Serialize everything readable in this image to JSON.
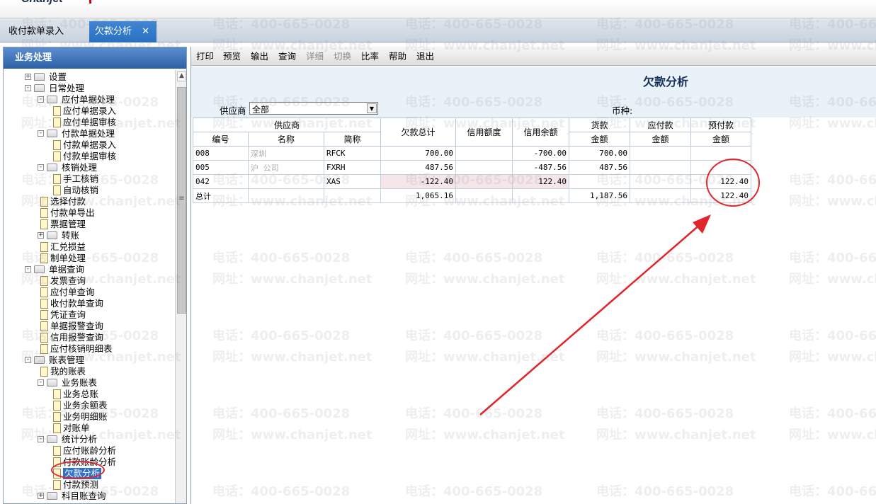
{
  "brand": {
    "name": "Chanjet"
  },
  "tabs": [
    {
      "label": "收付款单录入"
    },
    {
      "label": "欠款分析",
      "close": "✕"
    }
  ],
  "sidebar": {
    "title": "业务处理",
    "nodes": [
      {
        "label": "设置"
      },
      {
        "label": "日常处理"
      },
      {
        "label": "应付单据处理"
      },
      {
        "label": "应付单据录入"
      },
      {
        "label": "应付单据审核"
      },
      {
        "label": "付款单据处理"
      },
      {
        "label": "付款单据录入"
      },
      {
        "label": "付款单据审核"
      },
      {
        "label": "核销处理"
      },
      {
        "label": "手工核销"
      },
      {
        "label": "自动核销"
      },
      {
        "label": "选择付款"
      },
      {
        "label": "付款单导出"
      },
      {
        "label": "票据管理"
      },
      {
        "label": "转账"
      },
      {
        "label": "汇兑损益"
      },
      {
        "label": "制单处理"
      },
      {
        "label": "单据查询"
      },
      {
        "label": "发票查询"
      },
      {
        "label": "应付单查询"
      },
      {
        "label": "收付款单查询"
      },
      {
        "label": "凭证查询"
      },
      {
        "label": "单据报警查询"
      },
      {
        "label": "信用报警查询"
      },
      {
        "label": "应付核销明细表"
      },
      {
        "label": "账表管理"
      },
      {
        "label": "我的账表"
      },
      {
        "label": "业务账表"
      },
      {
        "label": "业务总账"
      },
      {
        "label": "业务余额表"
      },
      {
        "label": "业务明细账"
      },
      {
        "label": "对账单"
      },
      {
        "label": "统计分析"
      },
      {
        "label": "应付账龄分析"
      },
      {
        "label": "付款账龄分析"
      },
      {
        "label": "欠款分析"
      },
      {
        "label": "付款预测"
      },
      {
        "label": "科目账查询"
      }
    ]
  },
  "toolbar": {
    "buttons": [
      "打印",
      "预览",
      "输出",
      "查询",
      "详细",
      "切换",
      "比率",
      "帮助",
      "退出"
    ]
  },
  "report": {
    "title": "欠款分析",
    "vendor_label": "供应商",
    "vendor_value": "全部",
    "currency_label": "币种:"
  },
  "grid": {
    "headers": {
      "vendor_group": "供应商",
      "code": "编号",
      "name": "名称",
      "short": "简称",
      "total": "欠款总计",
      "credit": "信用额度",
      "credit_balance": "信用余额",
      "goods": "货款",
      "payable": "应付款",
      "prepay": "预付款",
      "amount": "金额"
    },
    "rows": [
      {
        "code": "008",
        "name": "深圳",
        "short": "RFCK",
        "total": "700.00",
        "credit": "",
        "balance": "-700.00",
        "goods": "700.00",
        "payable": "",
        "prepay": ""
      },
      {
        "code": "005",
        "name": "沪 公司",
        "short": "FXRH",
        "total": "487.56",
        "credit": "",
        "balance": "-487.56",
        "goods": "487.56",
        "payable": "",
        "prepay": ""
      },
      {
        "code": "042",
        "name": "",
        "short": "XAS",
        "total": "-122.40",
        "credit": "",
        "balance": "122.40",
        "goods": "",
        "payable": "",
        "prepay": "122.40"
      },
      {
        "code": "总计",
        "name": "",
        "short": "",
        "total": "1,065.16",
        "credit": "",
        "balance": "",
        "goods": "1,187.56",
        "payable": "",
        "prepay": "122.40"
      }
    ]
  },
  "watermark": {
    "phone": "电话：400-665-0028",
    "site": "网址：www.chanjet.net"
  },
  "colors": {
    "annotation": "#e0262c",
    "panel_header": "#2d5fa4",
    "active_tab": "#2a6fc0"
  }
}
